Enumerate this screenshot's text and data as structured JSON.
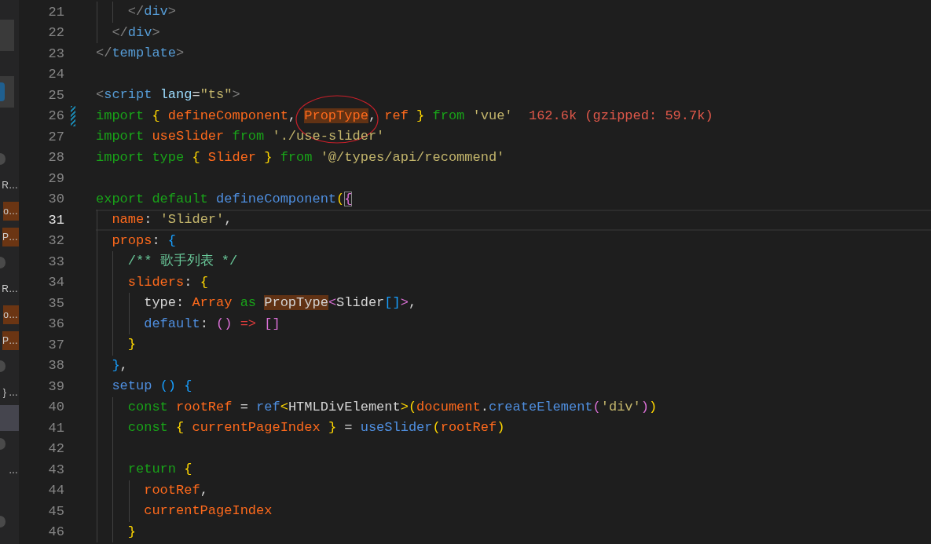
{
  "sidebar": {
    "items": [
      {
        "kind": "block",
        "selected": false
      },
      {
        "kind": "accent-block",
        "selected": false
      },
      {
        "kind": "badge",
        "selected": false
      },
      {
        "kind": "text",
        "text": "R…",
        "highlighted": false,
        "selected": false
      },
      {
        "kind": "text",
        "text": "o…",
        "highlighted": true,
        "selected": false
      },
      {
        "kind": "text",
        "text": "P…",
        "highlighted": true,
        "selected": false
      },
      {
        "kind": "badge",
        "selected": false
      },
      {
        "kind": "text",
        "text": "R…",
        "highlighted": false,
        "selected": false
      },
      {
        "kind": "text",
        "text": "o…",
        "highlighted": true,
        "selected": false
      },
      {
        "kind": "text",
        "text": "P…",
        "highlighted": true,
        "selected": false
      },
      {
        "kind": "badge",
        "selected": false
      },
      {
        "kind": "text",
        "text": "} …",
        "highlighted": false,
        "selected": false
      },
      {
        "kind": "empty",
        "selected": true
      },
      {
        "kind": "badge",
        "selected": false
      },
      {
        "kind": "text",
        "text": "…",
        "highlighted": false,
        "selected": false
      },
      {
        "kind": "empty",
        "selected": false
      },
      {
        "kind": "badge",
        "selected": false
      }
    ]
  },
  "editor": {
    "lines": [
      {
        "number": "21",
        "current": false,
        "modified": false,
        "tokens": [
          {
            "text": "    </",
            "kind": "tag"
          },
          {
            "text": "div",
            "kind": "tagname"
          },
          {
            "text": ">",
            "kind": "tag"
          }
        ]
      },
      {
        "number": "22",
        "current": false,
        "modified": false,
        "tokens": [
          {
            "text": "  </",
            "kind": "tag"
          },
          {
            "text": "div",
            "kind": "tagname"
          },
          {
            "text": ">",
            "kind": "tag"
          }
        ]
      },
      {
        "number": "23",
        "current": false,
        "modified": false,
        "tokens": [
          {
            "text": "</",
            "kind": "tag"
          },
          {
            "text": "template",
            "kind": "tagname"
          },
          {
            "text": ">",
            "kind": "tag"
          }
        ]
      },
      {
        "number": "24",
        "current": false,
        "modified": false
      },
      {
        "number": "25",
        "current": false,
        "modified": false,
        "tokens": [
          {
            "text": "<",
            "kind": "tag"
          },
          {
            "text": "script ",
            "kind": "tagname"
          },
          {
            "text": "lang",
            "kind": "attr"
          },
          {
            "text": "=",
            "kind": "plain"
          },
          {
            "text": "\"ts\"",
            "kind": "string"
          },
          {
            "text": ">",
            "kind": "tag"
          }
        ]
      },
      {
        "number": "26",
        "current": false,
        "modified": true,
        "tokens": [
          {
            "text": "import ",
            "kind": "keyword"
          },
          {
            "text": "{ ",
            "kind": "bracket1"
          },
          {
            "text": "defineComponent",
            "kind": "variable"
          },
          {
            "text": ", ",
            "kind": "plain"
          },
          {
            "text": "PropType",
            "kind": "variable",
            "highlighted": true,
            "circled": true
          },
          {
            "text": ", ",
            "kind": "plain"
          },
          {
            "text": "ref ",
            "kind": "variable"
          },
          {
            "text": "} ",
            "kind": "bracket1"
          },
          {
            "text": "from ",
            "kind": "keyword"
          },
          {
            "text": "'vue'  ",
            "kind": "string"
          },
          {
            "text": "162.6k (gzipped: 59.7k)",
            "kind": "hint"
          }
        ]
      },
      {
        "number": "27",
        "current": false,
        "modified": false,
        "tokens": [
          {
            "text": "import ",
            "kind": "keyword"
          },
          {
            "text": "useSlider ",
            "kind": "variable"
          },
          {
            "text": "from ",
            "kind": "keyword"
          },
          {
            "text": "'./use-slider'",
            "kind": "string"
          }
        ]
      },
      {
        "number": "28",
        "current": false,
        "modified": false,
        "tokens": [
          {
            "text": "import type ",
            "kind": "keyword"
          },
          {
            "text": "{ ",
            "kind": "bracket1"
          },
          {
            "text": "Slider ",
            "kind": "variable"
          },
          {
            "text": "} ",
            "kind": "bracket1"
          },
          {
            "text": "from ",
            "kind": "keyword"
          },
          {
            "text": "'@/types/api/recommend'",
            "kind": "string"
          }
        ]
      },
      {
        "number": "29",
        "current": false,
        "modified": false
      },
      {
        "number": "30",
        "current": false,
        "modified": false,
        "tokens": [
          {
            "text": "export default ",
            "kind": "keyword"
          },
          {
            "text": "defineComponent",
            "kind": "function"
          },
          {
            "text": "(",
            "kind": "bracket1"
          },
          {
            "text": "{",
            "kind": "bracket2",
            "matched": true
          }
        ]
      },
      {
        "number": "31",
        "current": true,
        "modified": false,
        "tokens": [
          {
            "text": "  name",
            "kind": "variable"
          },
          {
            "text": ": ",
            "kind": "plain"
          },
          {
            "text": "'Slider'",
            "kind": "string"
          },
          {
            "text": ",",
            "kind": "plain"
          }
        ]
      },
      {
        "number": "32",
        "current": false,
        "modified": false,
        "tokens": [
          {
            "text": "  props",
            "kind": "variable"
          },
          {
            "text": ": ",
            "kind": "plain"
          },
          {
            "text": "{",
            "kind": "bracket3"
          }
        ]
      },
      {
        "number": "33",
        "current": false,
        "modified": false,
        "tokens": [
          {
            "text": "    /** 歌手列表 */",
            "kind": "comment"
          }
        ]
      },
      {
        "number": "34",
        "current": false,
        "modified": false,
        "tokens": [
          {
            "text": "    sliders",
            "kind": "variable"
          },
          {
            "text": ": ",
            "kind": "plain"
          },
          {
            "text": "{",
            "kind": "bracket1"
          }
        ]
      },
      {
        "number": "35",
        "current": false,
        "modified": false,
        "tokens": [
          {
            "text": "      type: ",
            "kind": "plain"
          },
          {
            "text": "Array ",
            "kind": "variable"
          },
          {
            "text": "as ",
            "kind": "keyword"
          },
          {
            "text": "PropType",
            "kind": "plain",
            "highlighted": true
          },
          {
            "text": "<",
            "kind": "bracket2"
          },
          {
            "text": "Slider",
            "kind": "plain"
          },
          {
            "text": "[]",
            "kind": "bracket3"
          },
          {
            "text": ">",
            "kind": "bracket2"
          },
          {
            "text": ",",
            "kind": "plain"
          }
        ]
      },
      {
        "number": "36",
        "current": false,
        "modified": false,
        "tokens": [
          {
            "text": "      default",
            "kind": "function"
          },
          {
            "text": ": ",
            "kind": "plain"
          },
          {
            "text": "() ",
            "kind": "bracket2"
          },
          {
            "text": "=> ",
            "kind": "operator"
          },
          {
            "text": "[]",
            "kind": "bracket2"
          }
        ]
      },
      {
        "number": "37",
        "current": false,
        "modified": false,
        "tokens": [
          {
            "text": "    }",
            "kind": "bracket1"
          }
        ]
      },
      {
        "number": "38",
        "current": false,
        "modified": false,
        "tokens": [
          {
            "text": "  }",
            "kind": "bracket3"
          },
          {
            "text": ",",
            "kind": "plain"
          }
        ]
      },
      {
        "number": "39",
        "current": false,
        "modified": false,
        "tokens": [
          {
            "text": "  setup ",
            "kind": "function"
          },
          {
            "text": "() {",
            "kind": "bracket3"
          }
        ]
      },
      {
        "number": "40",
        "current": false,
        "modified": false,
        "tokens": [
          {
            "text": "    const ",
            "kind": "keyword"
          },
          {
            "text": "rootRef",
            "kind": "variable"
          },
          {
            "text": " = ",
            "kind": "plain"
          },
          {
            "text": "ref",
            "kind": "function"
          },
          {
            "text": "<",
            "kind": "bracket1"
          },
          {
            "text": "HTMLDivElement",
            "kind": "plain"
          },
          {
            "text": ">(",
            "kind": "bracket1"
          },
          {
            "text": "document",
            "kind": "variable"
          },
          {
            "text": ".",
            "kind": "plain"
          },
          {
            "text": "createElement",
            "kind": "function"
          },
          {
            "text": "(",
            "kind": "bracket2"
          },
          {
            "text": "'div'",
            "kind": "string"
          },
          {
            "text": ")",
            "kind": "bracket2"
          },
          {
            "text": ")",
            "kind": "bracket1"
          }
        ]
      },
      {
        "number": "41",
        "current": false,
        "modified": false,
        "tokens": [
          {
            "text": "    const ",
            "kind": "keyword"
          },
          {
            "text": "{ ",
            "kind": "bracket1"
          },
          {
            "text": "currentPageIndex ",
            "kind": "variable"
          },
          {
            "text": "}",
            "kind": "bracket1"
          },
          {
            "text": " = ",
            "kind": "plain"
          },
          {
            "text": "useSlider",
            "kind": "function"
          },
          {
            "text": "(",
            "kind": "bracket1"
          },
          {
            "text": "rootRef",
            "kind": "variable"
          },
          {
            "text": ")",
            "kind": "bracket1"
          }
        ]
      },
      {
        "number": "42",
        "current": false,
        "modified": false
      },
      {
        "number": "43",
        "current": false,
        "modified": false,
        "tokens": [
          {
            "text": "    return ",
            "kind": "keyword"
          },
          {
            "text": "{",
            "kind": "bracket1"
          }
        ]
      },
      {
        "number": "44",
        "current": false,
        "modified": false,
        "tokens": [
          {
            "text": "      rootRef",
            "kind": "variable"
          },
          {
            "text": ",",
            "kind": "plain"
          }
        ]
      },
      {
        "number": "45",
        "current": false,
        "modified": false,
        "tokens": [
          {
            "text": "      currentPageIndex",
            "kind": "variable"
          }
        ]
      },
      {
        "number": "46",
        "current": false,
        "modified": false,
        "tokens": [
          {
            "text": "    }",
            "kind": "bracket1"
          }
        ]
      }
    ]
  }
}
